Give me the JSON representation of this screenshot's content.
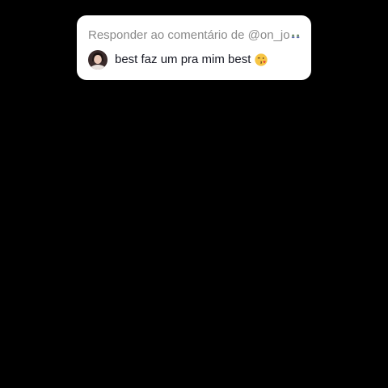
{
  "reply_card": {
    "header_text": "Responder ao comentário de @on_jo",
    "header_icons": [
      "zombie-woman-emoji-icon",
      "zombie-woman-emoji-icon"
    ],
    "comment_text": "best faz um pra mim best",
    "comment_icon": "face-blowing-kiss-emoji-icon",
    "avatar_icon": "user-avatar"
  },
  "colors": {
    "background": "#000000",
    "card": "#ffffff",
    "header_text": "#8a8a8a",
    "comment_text": "#161823"
  }
}
